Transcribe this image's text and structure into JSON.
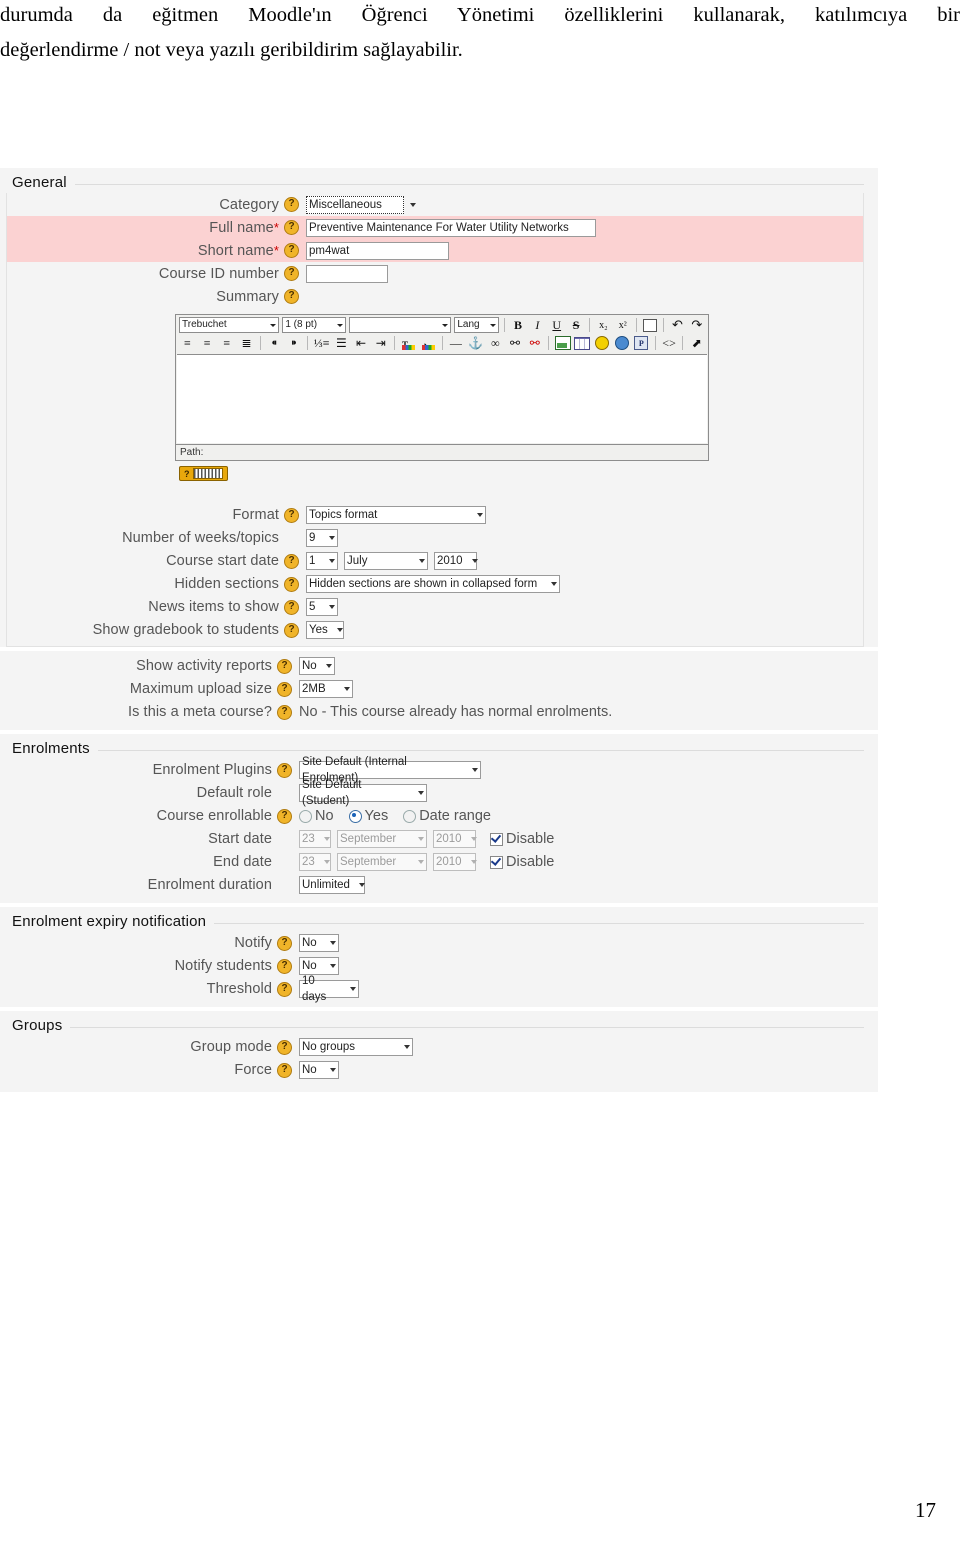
{
  "document": {
    "paragraph_line1": "durumda da eğitmen Moodle'ın Öğrenci Yönetimi özelliklerini kullanarak, katılımcıya bir",
    "paragraph_line2": "değerlendirme / not veya yazılı geribildirim sağlayabilir.",
    "page_number": "17"
  },
  "screenshot": {
    "sections": {
      "general": {
        "title": "General",
        "rows": {
          "category": {
            "label": "Category",
            "value": "Miscellaneous"
          },
          "full_name": {
            "label": "Full name",
            "value": "Preventive Maintenance For Water Utility Networks",
            "required": "*"
          },
          "short_name": {
            "label": "Short name",
            "value": "pm4wat",
            "required": "*"
          },
          "course_id": {
            "label": "Course ID number",
            "value": ""
          },
          "summary": {
            "label": "Summary"
          },
          "format": {
            "label": "Format",
            "value": "Topics format"
          },
          "weeks": {
            "label": "Number of weeks/topics",
            "value": "9"
          },
          "start_date": {
            "label": "Course start date",
            "day": "1",
            "month": "July",
            "year": "2010"
          },
          "hidden_sections": {
            "label": "Hidden sections",
            "value": "Hidden sections are shown in collapsed form"
          },
          "news_items": {
            "label": "News items to show",
            "value": "5"
          },
          "gradebook": {
            "label": "Show gradebook to students",
            "value": "Yes"
          },
          "activity_reports": {
            "label": "Show activity reports",
            "value": "No"
          },
          "upload_size": {
            "label": "Maximum upload size",
            "value": "2MB"
          },
          "meta_course": {
            "label": "Is this a meta course?",
            "value": "No - This course already has normal enrolments."
          }
        }
      },
      "enrolments": {
        "title": "Enrolments",
        "rows": {
          "plugins": {
            "label": "Enrolment Plugins",
            "value": "Site Default (Internal Enrolment)"
          },
          "default_role": {
            "label": "Default role",
            "value": "Site Default (Student)"
          },
          "enrollable": {
            "label": "Course enrollable",
            "options": [
              "No",
              "Yes",
              "Date range"
            ],
            "selected": "Yes"
          },
          "start_date": {
            "label": "Start date",
            "day": "23",
            "month": "September",
            "year": "2010",
            "disable_label": "Disable",
            "disabled": "true"
          },
          "end_date": {
            "label": "End date",
            "day": "23",
            "month": "September",
            "year": "2010",
            "disable_label": "Disable",
            "disabled": "true"
          },
          "duration": {
            "label": "Enrolment duration",
            "value": "Unlimited"
          }
        }
      },
      "expiry": {
        "title": "Enrolment expiry notification",
        "rows": {
          "notify": {
            "label": "Notify",
            "value": "No"
          },
          "notify_students": {
            "label": "Notify students",
            "value": "No"
          },
          "threshold": {
            "label": "Threshold",
            "value": "10 days"
          }
        }
      },
      "groups": {
        "title": "Groups",
        "rows": {
          "group_mode": {
            "label": "Group mode",
            "value": "No groups"
          },
          "force": {
            "label": "Force",
            "value": "No"
          }
        }
      }
    },
    "editor": {
      "font_family": "Trebuchet",
      "font_size": "1 (8 pt)",
      "format_block": "",
      "language": "Lang",
      "path_label": "Path:",
      "buttons_row1": [
        "B",
        "I",
        "U",
        "S",
        "x₂",
        "x²",
        "spellcheck-icon",
        "undo-icon",
        "redo-icon"
      ],
      "buttons_row2": [
        "align-left-icon",
        "align-center-icon",
        "align-right-icon",
        "align-justify-icon",
        "ltr-icon",
        "rtl-icon",
        "ordered-list-icon",
        "unordered-list-icon",
        "outdent-icon",
        "indent-icon",
        "forecolor-icon",
        "backcolor-icon",
        "horizontal-rule-icon",
        "anchor-icon",
        "insert-link-icon",
        "unlink-icon",
        "remove-link-icon",
        "insert-image-icon",
        "insert-table-icon",
        "smiley-icon",
        "special-char-icon",
        "search-replace-icon",
        "html-source-icon",
        "fullscreen-icon"
      ]
    },
    "colors": {
      "required_row": "#fbd2d2",
      "panel_bg": "#f4f4f4",
      "help_icon": "#f0b429",
      "radio_selected": "#1a62b8"
    }
  }
}
